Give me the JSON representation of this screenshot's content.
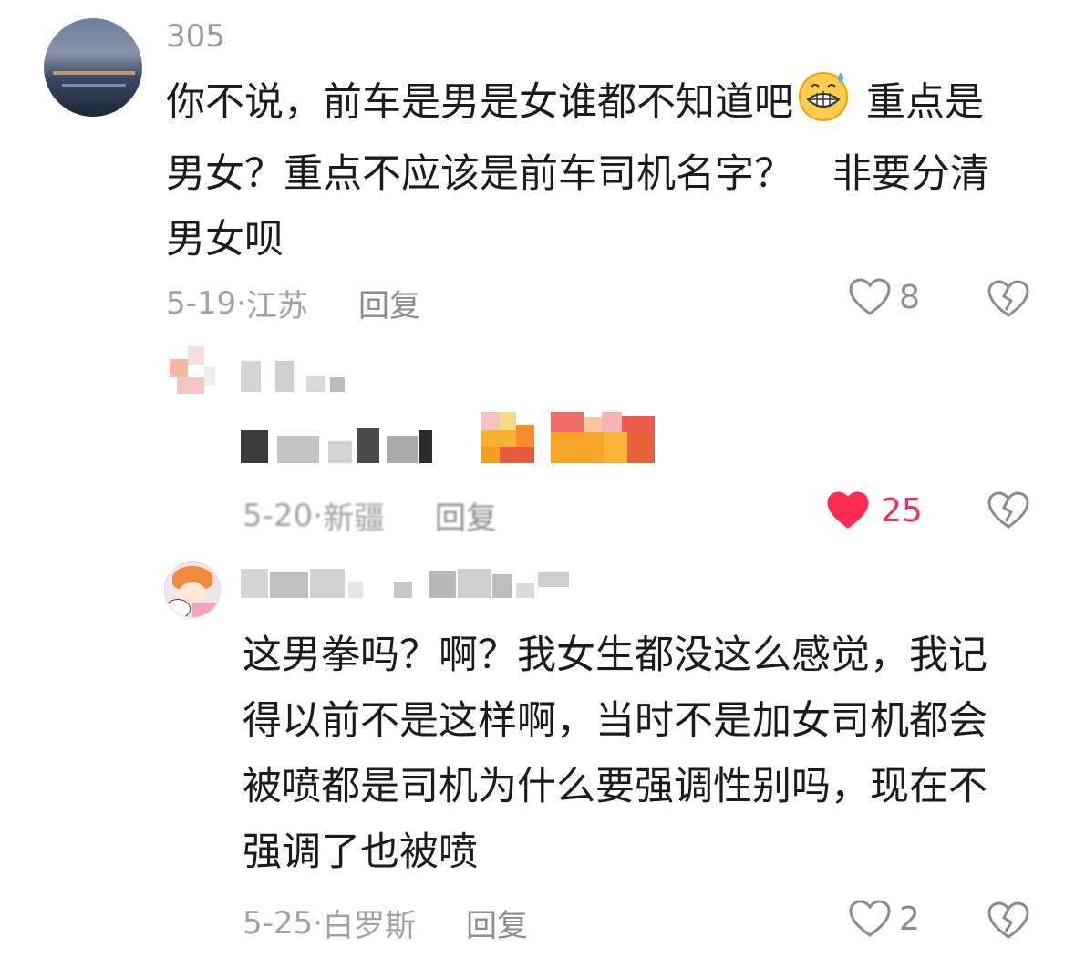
{
  "comments": [
    {
      "username": "305",
      "text_lines": [
        "你不说，前车是男是女谁都不知道吧",
        "重点是",
        "男女？重点不应该是前车司机名字？　非要分清",
        "男女呗"
      ],
      "emoji": "grimacing-sweat-emoji",
      "date": "5-19",
      "location": "江苏",
      "reply_label": "回复",
      "like_count": "8",
      "liked": false
    },
    {
      "username": "",
      "date": "5-20",
      "location": "新疆",
      "reply_label": "回复",
      "like_count": "25",
      "liked": true
    },
    {
      "username": "",
      "text_lines": [
        "这男拳吗？啊？我女生都没这么感觉，我记",
        "得以前不是这样啊，当时不是加女司机都会",
        "被喷都是司机为什么要强调性别吗，现在不",
        "强调了也被喷"
      ],
      "date": "5-25",
      "location": "白罗斯",
      "reply_label": "回复",
      "like_count": "2",
      "liked": false
    }
  ],
  "colors": {
    "liked": "#fe2c55",
    "muted": "#a0a2a8",
    "text": "#1b1b1f"
  },
  "icons": {
    "like": "heart-icon",
    "dislike": "broken-heart-icon"
  }
}
